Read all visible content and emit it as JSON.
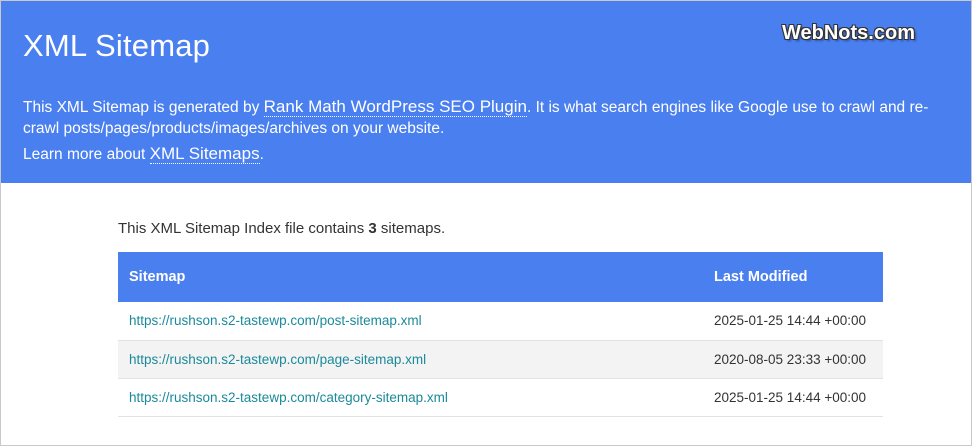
{
  "header": {
    "title": "XML Sitemap",
    "desc_prefix": "This XML Sitemap is generated by ",
    "plugin_link": "Rank Math WordPress SEO Plugin",
    "desc_suffix": ". It is what search engines like Google use to crawl and re-crawl posts/pages/products/images/archives on your website.",
    "learn_prefix": "Learn more about ",
    "learn_link": "XML Sitemaps",
    "learn_suffix": "."
  },
  "watermark": "WebNots.com",
  "summary": {
    "prefix": "This XML Sitemap Index file contains ",
    "count": "3",
    "suffix": " sitemaps."
  },
  "table": {
    "headers": [
      "Sitemap",
      "Last Modified"
    ],
    "rows": [
      {
        "url": "https://rushson.s2-tastewp.com/post-sitemap.xml",
        "modified": "2025-01-25 14:44 +00:00"
      },
      {
        "url": "https://rushson.s2-tastewp.com/page-sitemap.xml",
        "modified": "2020-08-05 23:33 +00:00"
      },
      {
        "url": "https://rushson.s2-tastewp.com/category-sitemap.xml",
        "modified": "2025-01-25 14:44 +00:00"
      }
    ]
  },
  "colors": {
    "header_bg": "#4a7ff0",
    "link": "#1a8a9a",
    "alt_row": "#f3f3f3"
  }
}
